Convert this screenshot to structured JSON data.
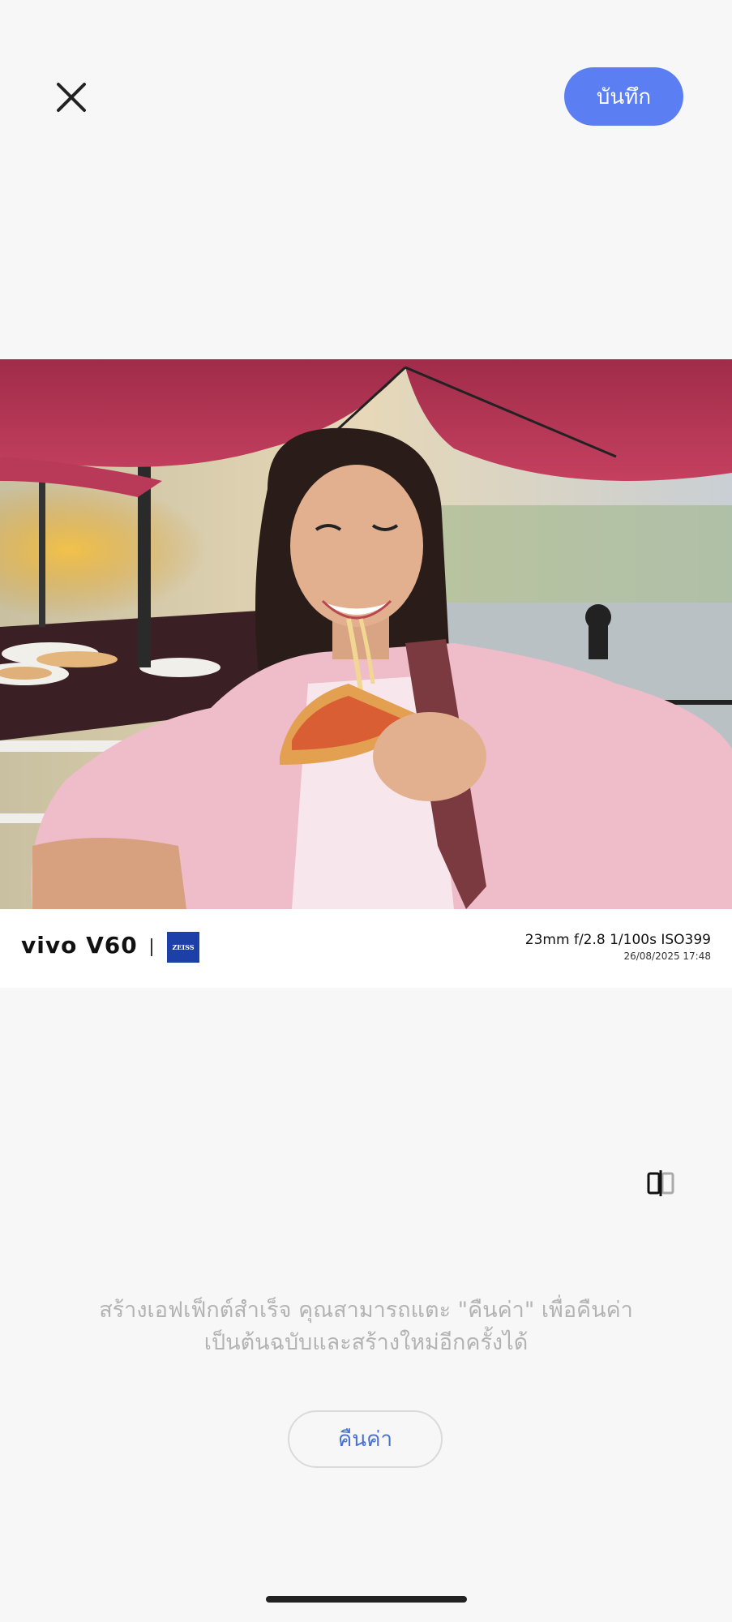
{
  "header": {
    "close_icon": "close-icon",
    "save_label": "บันทึก"
  },
  "photo": {
    "description_icon": "photo-preview",
    "watermark": {
      "brand": "vivo V60",
      "zeiss": "ZEISS",
      "exif": "23mm  f/2.8  1/100s  ISO399",
      "datetime": "26/08/2025 17:48"
    }
  },
  "compare_icon": "compare-icon",
  "message": {
    "line1": "สร้างเอฟเฟ็กต์สำเร็จ คุณสามารถแตะ \"คืนค่า\" เพื่อคืนค่า",
    "line2": "เป็นต้นฉบับและสร้างใหม่อีกครั้งได้"
  },
  "reset_label": "คืนค่า",
  "colors": {
    "accent": "#5b7ff2",
    "reset_text": "#4a6fd6",
    "background": "#f7f7f7"
  }
}
